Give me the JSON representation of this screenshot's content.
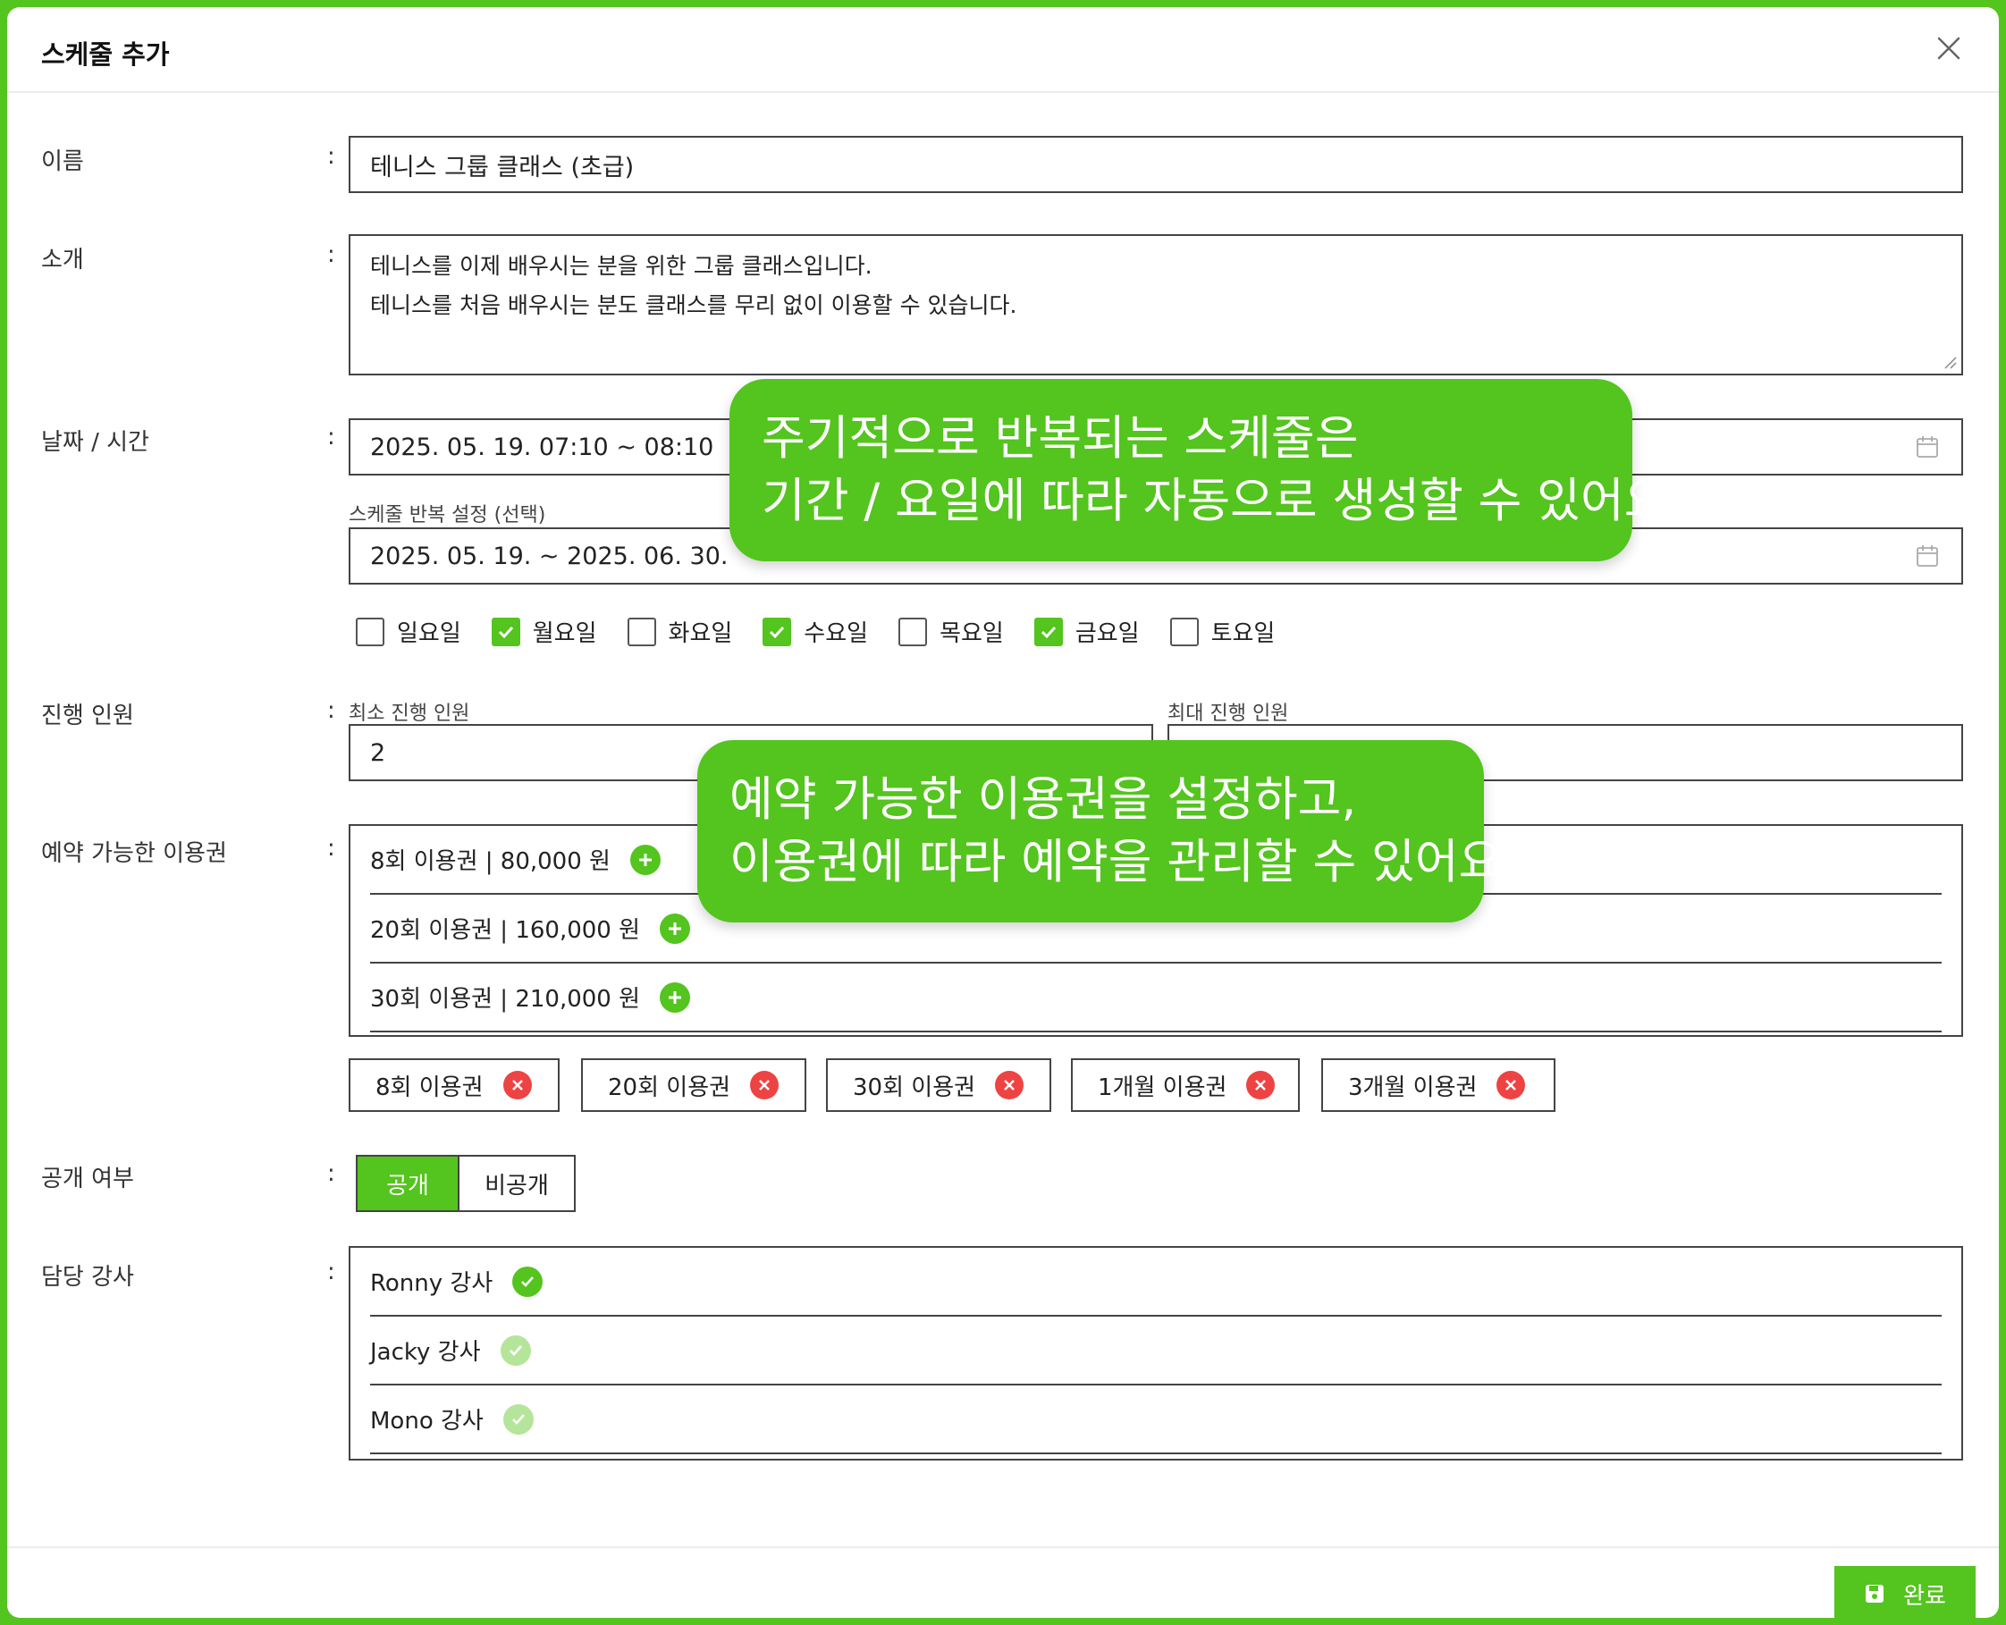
{
  "dialog": {
    "title": "스케줄 추가"
  },
  "name": {
    "label": "이름",
    "value": "테니스 그룹 클래스 (초급)"
  },
  "intro": {
    "label": "소개",
    "lines": [
      "테니스를 이제 배우시는 분을 위한 그룹 클래스입니다.",
      "테니스를 처음 배우시는 분도 클래스를 무리 없이 이용할 수 있습니다."
    ]
  },
  "datetime": {
    "label": "날짜 / 시간",
    "value": "2025. 05. 19. 07:10 ~ 08:10",
    "repeat_label": "스케줄 반복 설정 (선택)",
    "repeat_value": "2025. 05. 19. ~ 2025. 06. 30."
  },
  "days": [
    {
      "label": "일요일",
      "checked": false
    },
    {
      "label": "월요일",
      "checked": true
    },
    {
      "label": "화요일",
      "checked": false
    },
    {
      "label": "수요일",
      "checked": true
    },
    {
      "label": "목요일",
      "checked": false
    },
    {
      "label": "금요일",
      "checked": true
    },
    {
      "label": "토요일",
      "checked": false
    }
  ],
  "participants": {
    "label": "진행 인원",
    "min_label": "최소 진행 인원",
    "min_value": "2",
    "max_label": "최대 진행 인원",
    "max_value": ""
  },
  "passes": {
    "label": "예약 가능한 이용권",
    "options": [
      "8회 이용권 | 80,000 원",
      "20회 이용권 | 160,000 원",
      "30회 이용권 | 210,000 원"
    ],
    "selected": [
      "8회 이용권",
      "20회 이용권",
      "30회 이용권",
      "1개월 이용권",
      "3개월 이용권"
    ]
  },
  "visibility": {
    "label": "공개 여부",
    "public": "공개",
    "private": "비공개",
    "selected": "공개"
  },
  "instructors": {
    "label": "담당 강사",
    "items": [
      {
        "name": "Ronny 강사",
        "selected": true
      },
      {
        "name": "Jacky 강사",
        "selected": false
      },
      {
        "name": "Mono 강사",
        "selected": false
      }
    ]
  },
  "footer": {
    "done_label": "완료"
  },
  "callouts": {
    "repeat": [
      "주기적으로 반복되는 스케줄은",
      "기간 / 요일에 따라 자동으로 생성할 수 있어요."
    ],
    "passes": [
      "예약 가능한 이용권을 설정하고,",
      "이용권에 따라 예약을 관리할 수 있어요."
    ]
  },
  "colors": {
    "accent": "#54c41e",
    "remove": "#ee4343",
    "muted_check": "#b5e59a"
  }
}
